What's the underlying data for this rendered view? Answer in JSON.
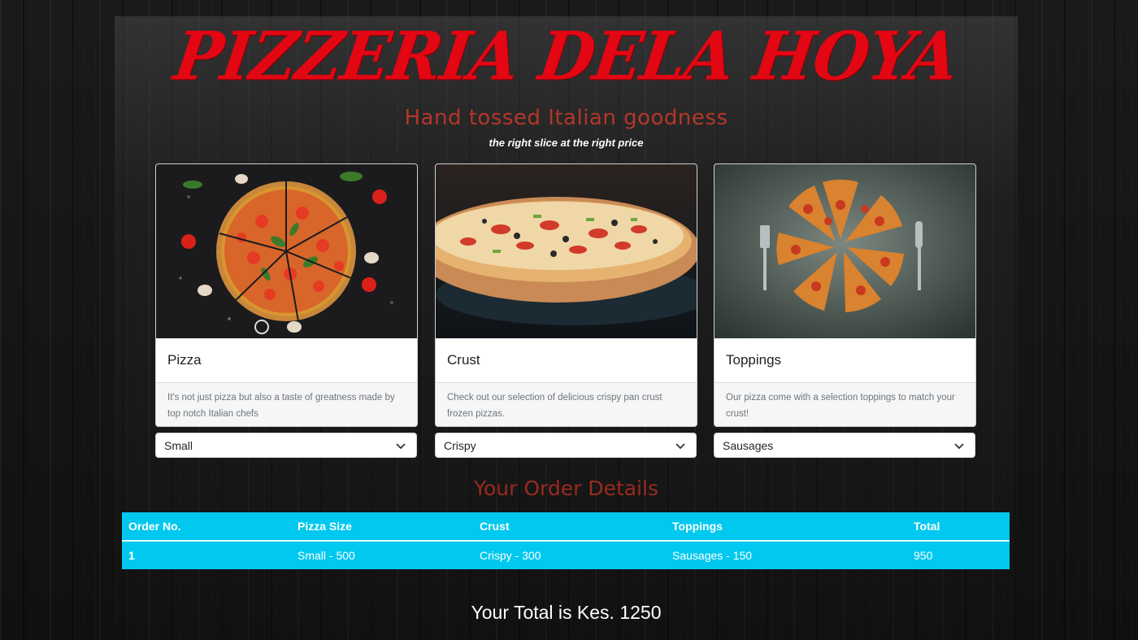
{
  "header": {
    "brand": "PIZZERIA DELA HOYA",
    "tagline": "Hand tossed Italian goodness",
    "subtagline": "the right slice at the right price"
  },
  "cards": [
    {
      "title": "Pizza",
      "text": "It's not just pizza but also a taste of greatness made by top notch Italian chefs",
      "image": "pizza-photo"
    },
    {
      "title": "Crust",
      "text": "Check out our selection of delicious crispy pan crust frozen pizzas.",
      "image": "crust-photo"
    },
    {
      "title": "Toppings",
      "text": "Our pizza come with a selection toppings to match your crust!",
      "image": "toppings-photo"
    }
  ],
  "selects": {
    "size": "Small",
    "crust": "Crispy",
    "topping": "Sausages"
  },
  "order": {
    "title": "Your Order Details",
    "columns": [
      "Order No.",
      "Pizza Size",
      "Crust",
      "Toppings",
      "Total"
    ],
    "rows": [
      [
        "1",
        "Small - 500",
        "Crispy - 300",
        "Sausages - 150",
        "950"
      ]
    ]
  },
  "total_text": "Your Total is Kes. 1250",
  "colors": {
    "brand": "#e30613",
    "tagline": "#b4362a",
    "table": "#00c8ef"
  }
}
